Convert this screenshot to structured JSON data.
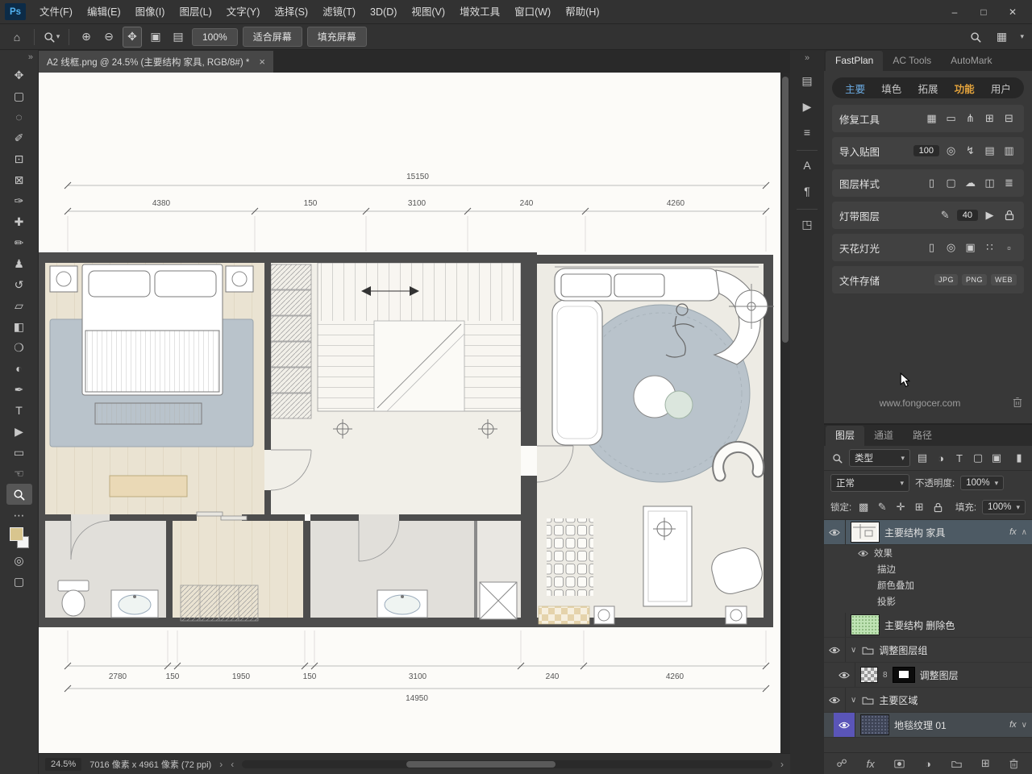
{
  "app": {
    "logo": "Ps",
    "window": {
      "minimize": "–",
      "maximize": "□",
      "close": "✕"
    }
  },
  "menu": {
    "items": [
      "文件(F)",
      "编辑(E)",
      "图像(I)",
      "图层(L)",
      "文字(Y)",
      "选择(S)",
      "滤镜(T)",
      "3D(D)",
      "视图(V)",
      "增效工具",
      "窗口(W)",
      "帮助(H)"
    ]
  },
  "options": {
    "buttons": [
      "100%",
      "适合屏幕",
      "填充屏幕"
    ]
  },
  "tab": {
    "title": "A2 线框.png @ 24.5% (主要结构 家具, RGB/8#) *"
  },
  "plan": {
    "total_top": "15150",
    "dims_top": [
      "4380",
      "150",
      "3100",
      "240",
      "4260"
    ],
    "dims_bottom": [
      "2780",
      "150",
      "1950",
      "150",
      "3100",
      "240",
      "4260"
    ],
    "total_bottom": "14950"
  },
  "fastplan": {
    "panel_tabs": [
      "FastPlan",
      "AC Tools",
      "AutoMark"
    ],
    "subtabs": [
      "主要",
      "填色",
      "拓展",
      "功能",
      "用户"
    ],
    "rows": {
      "repair": "修复工具",
      "import": "导入贴图",
      "import_value": "100",
      "style": "图层样式",
      "light_strip": "灯带图层",
      "light_value": "40",
      "ceiling": "天花灯光",
      "storage": "文件存储",
      "files": [
        "JPG",
        "PNG",
        "WEB"
      ]
    },
    "website": "www.fongocer.com"
  },
  "layers_panel": {
    "tabs": [
      "图层",
      "通道",
      "路径"
    ],
    "filter_label": "类型",
    "blend_mode": "正常",
    "opacity_label": "不透明度:",
    "opacity_value": "100%",
    "lock_label": "锁定:",
    "fill_label": "填充:",
    "fill_value": "100%",
    "fx_label": "fx",
    "link_digit": "8",
    "layers": [
      {
        "name": "主要结构 家具"
      },
      {
        "name": "效果"
      },
      {
        "name": "描边"
      },
      {
        "name": "颜色叠加"
      },
      {
        "name": "投影"
      },
      {
        "name": "主要结构 删除色"
      },
      {
        "name": "调整图层组"
      },
      {
        "name": "调整图层"
      },
      {
        "name": "主要区域"
      },
      {
        "name": "地毯纹理 01"
      }
    ]
  },
  "status": {
    "zoom": "24.5%",
    "doc_info": "7016 像素 x 4961 像素 (72 ppi)"
  },
  "glyphs": {
    "collapse": "»",
    "home": "⌂",
    "caret": "▾",
    "zoom_in": "⊕",
    "zoom_out": "⊖",
    "pan": "✥",
    "win1": "▣",
    "win2": "▤",
    "more": "⋯",
    "move": "✥",
    "marquee": "▢",
    "lasso": "◌",
    "quick_select": "✐",
    "crop": "⊡",
    "slice": "⊠",
    "eyedropper": "✑",
    "healing": "✚",
    "brush": "✏",
    "stamp": "♟",
    "history": "↺",
    "eraser": "▱",
    "gradient": "◧",
    "blur": "❍",
    "dodge": "◐",
    "pen": "✒",
    "type": "T",
    "path_select": "▶",
    "shape": "▭",
    "hand": "☜",
    "quickmask": "◎",
    "screen": "▢",
    "p_brushes": "▤",
    "p_actions": "▶",
    "p_adjust": "≡",
    "p_char": "A",
    "p_para": "¶",
    "p_3d": "◳",
    "grid": "▦",
    "rounded": "▭",
    "fork": "⋔",
    "plus_sq": "⊞",
    "minus_sq": "⊟",
    "target": "◎",
    "bolt": "↯",
    "img1": "▤",
    "img2": "▥",
    "page": "▯",
    "doc": "▢",
    "cloud": "☁",
    "bucket": "◫",
    "lines": "≣",
    "pencil": "✎",
    "play": "▶",
    "dots": "∷",
    "small_sq": "▫",
    "f_img": "▤",
    "f_adj": "◑",
    "f_type": "T",
    "f_shape": "▢",
    "f_smart": "▣",
    "toggle": "▮",
    "lock_t": "▩",
    "lock_p": "✎",
    "lock_m": "✛",
    "lock_a": "⊞",
    "chain": "☍",
    "adj_circle": "◑",
    "new_sq": "⊞",
    "chev_up": "∧",
    "chev_down": "∨",
    "chev_left": "‹",
    "chev_right": "›",
    "close": "×"
  },
  "colors": {
    "accent_orange": "#e2a23c",
    "accent_blue": "#6aa9e0",
    "selected_layer": "#4d5a64",
    "violet_label": "#5a55b8",
    "foreground_swatch": "#d8c58e"
  }
}
